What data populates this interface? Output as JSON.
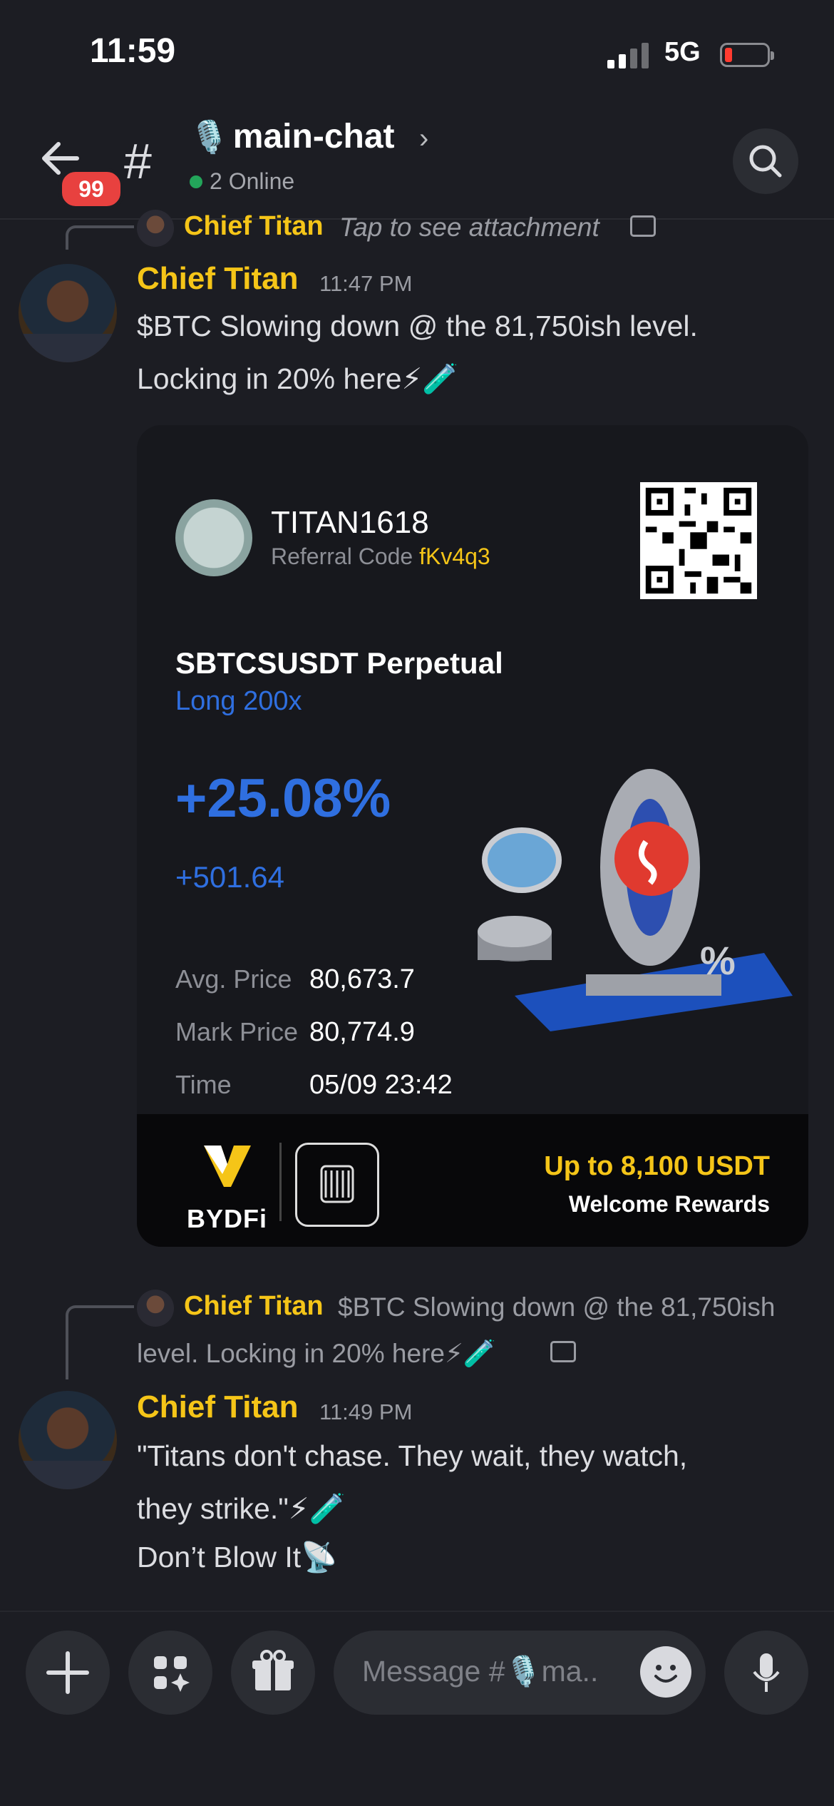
{
  "status_bar": {
    "time": "11:59",
    "network": "5G"
  },
  "header": {
    "unread_badge": "99",
    "channel_name": "main-chat",
    "channel_icon": "microphone-emoji",
    "online_text": "2 Online"
  },
  "messages": [
    {
      "reply_author": "Chief Titan",
      "reply_text": "Tap to see attachment",
      "author": "Chief Titan",
      "time": "11:47 PM",
      "line1": "$BTC  Slowing down @ the 81,750ish level.",
      "line2": "Locking in 20% here",
      "emojis": "⚡🧪"
    },
    {
      "reply_author": "Chief Titan",
      "reply_text_1": "$BTC  Slowing down @ the 81,750ish",
      "reply_text_2": "level. Locking in 20% here",
      "reply_emojis": "⚡🧪",
      "author": "Chief Titan",
      "time": "11:49 PM",
      "line1": "\"Titans don't chase. They wait, they watch,",
      "line2": "they strike.\"",
      "line2_emojis": "⚡🧪",
      "line3": "Don’t Blow It",
      "line3_emoji": "📡"
    }
  ],
  "card": {
    "username": "TITAN1618",
    "referral_label": "Referral Code",
    "referral_code": "fKv4q3",
    "pair": "SBTCSUSDT Perpetual",
    "side": "Long 200x",
    "pnl_percent": "+25.08%",
    "pnl_amount": "+501.64",
    "avg_label": "Avg. Price",
    "avg_value": "80,673.7",
    "mark_label": "Mark Price",
    "mark_value": "80,774.9",
    "time_label": "Time",
    "time_value": "05/09 23:42",
    "brand": "BYDFi",
    "promo_line1": "Up to 8,100 USDT",
    "promo_line2": "Welcome Rewards",
    "colors": {
      "accent_blue": "#2f6fe0",
      "accent_yellow": "#f5c518"
    }
  },
  "input": {
    "placeholder": "Message #🎙️ma.."
  }
}
